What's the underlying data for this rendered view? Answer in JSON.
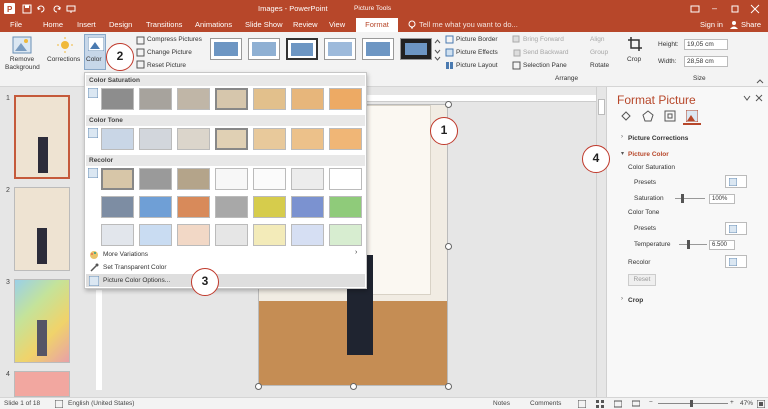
{
  "titlebar": {
    "title": "Images - PowerPoint",
    "context": "Picture Tools",
    "sign_in": "Sign in",
    "share": "Share"
  },
  "tabs": [
    "File",
    "Home",
    "Insert",
    "Design",
    "Transitions",
    "Animations",
    "Slide Show",
    "Review",
    "View",
    "Format"
  ],
  "tell_me": "Tell me what you want to do...",
  "ribbon": {
    "remove_background": "Remove Background",
    "corrections": "Corrections",
    "color": "Color",
    "compress": "Compress Pictures",
    "change": "Change Picture",
    "reset": "Reset Picture",
    "border": "Picture Border",
    "effects": "Picture Effects",
    "layout": "Picture Layout",
    "bring_forward": "Bring Forward",
    "send_backward": "Send Backward",
    "selection_pane": "Selection Pane",
    "align": "Align",
    "group": "Group",
    "rotate": "Rotate",
    "arrange": "Arrange",
    "crop": "Crop",
    "height_label": "Height:",
    "height_value": "19,05 cm",
    "width_label": "Width:",
    "width_value": "28,58 cm",
    "size": "Size"
  },
  "dropdown": {
    "saturation_header": "Color Saturation",
    "tone_header": "Color Tone",
    "recolor_header": "Recolor",
    "more_variations": "More Variations",
    "set_transparent": "Set Transparent Color",
    "color_options": "Picture Color Options..."
  },
  "thumbnails": [
    "1",
    "2",
    "3",
    "4"
  ],
  "callouts": [
    "1",
    "2",
    "3",
    "4"
  ],
  "pane": {
    "title": "Format Picture",
    "corrections": "Picture Corrections",
    "color": "Picture Color",
    "saturation_section": "Color Saturation",
    "presets": "Presets",
    "saturation": "Saturation",
    "saturation_value": "100%",
    "tone_section": "Color Tone",
    "presets2": "Presets",
    "temperature": "Temperature",
    "temperature_value": "6.500",
    "recolor": "Recolor",
    "reset": "Reset",
    "crop": "Crop"
  },
  "status": {
    "slide": "Slide 1 of 18",
    "language": "English (United States)",
    "notes": "Notes",
    "comments": "Comments",
    "zoom": "47%"
  },
  "colors": {
    "accent": "#b7472a",
    "callout": "#c0392b"
  }
}
